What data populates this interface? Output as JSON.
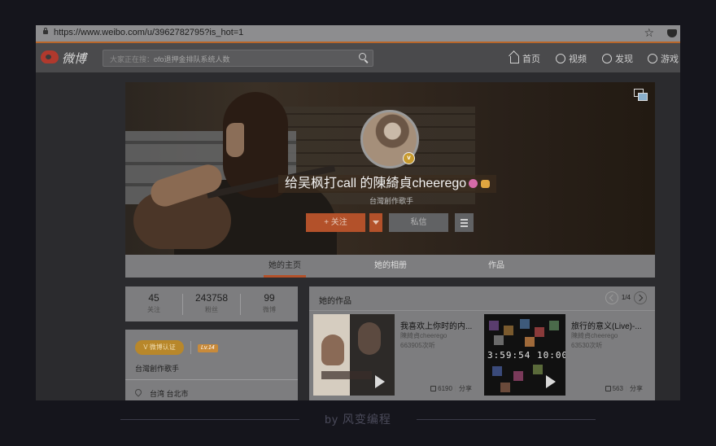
{
  "browser": {
    "url": "https://www.weibo.com/u/3962782795?is_hot=1",
    "bookmark_icon": "star-icon",
    "pocket_icon": "pocket-icon"
  },
  "header": {
    "logo_text": "微博",
    "search_prefix": "大家正在搜：",
    "search_placeholder": "ofo退押金排队系统人数",
    "nav": [
      {
        "label": "首页",
        "icon": "home-icon"
      },
      {
        "label": "视频",
        "icon": "video-icon"
      },
      {
        "label": "发现",
        "icon": "compass-icon"
      },
      {
        "label": "游戏",
        "icon": "game-icon"
      }
    ]
  },
  "profile": {
    "name": "给吴枫打call 的陳綺貞cheerego",
    "bio": "台灣創作歌手",
    "follow_label": "+ 关注",
    "message_label": "私信",
    "verified_label": "微博认证",
    "level": "Lv.14",
    "about": "台灣創作歌手",
    "location": "台湾  台北市"
  },
  "tabs": [
    {
      "label": "她的主页",
      "active": true
    },
    {
      "label": "她的相册",
      "active": false
    },
    {
      "label": "作品",
      "active": false
    }
  ],
  "stats": [
    {
      "value": "45",
      "label": "关注"
    },
    {
      "value": "243758",
      "label": "粉丝"
    },
    {
      "value": "99",
      "label": "微博"
    }
  ],
  "works": {
    "title": "她的作品",
    "page": "1/4",
    "items": [
      {
        "title": "我喜欢上你时的内...",
        "artist": "陳綺貞cheerego",
        "plays": "663905次听",
        "likes": "6190",
        "share": "分享"
      },
      {
        "title": "旅行的意义(Live)-...",
        "artist": "陳綺貞cheerego",
        "plays": "63530次听",
        "likes": "563",
        "share": "分享"
      }
    ],
    "cover2_text": "3:59:54 10:00"
  },
  "credit": "by 风变编程",
  "colors": {
    "accent": "#b3512a",
    "verified": "#b8872a",
    "background": "#15151c"
  }
}
